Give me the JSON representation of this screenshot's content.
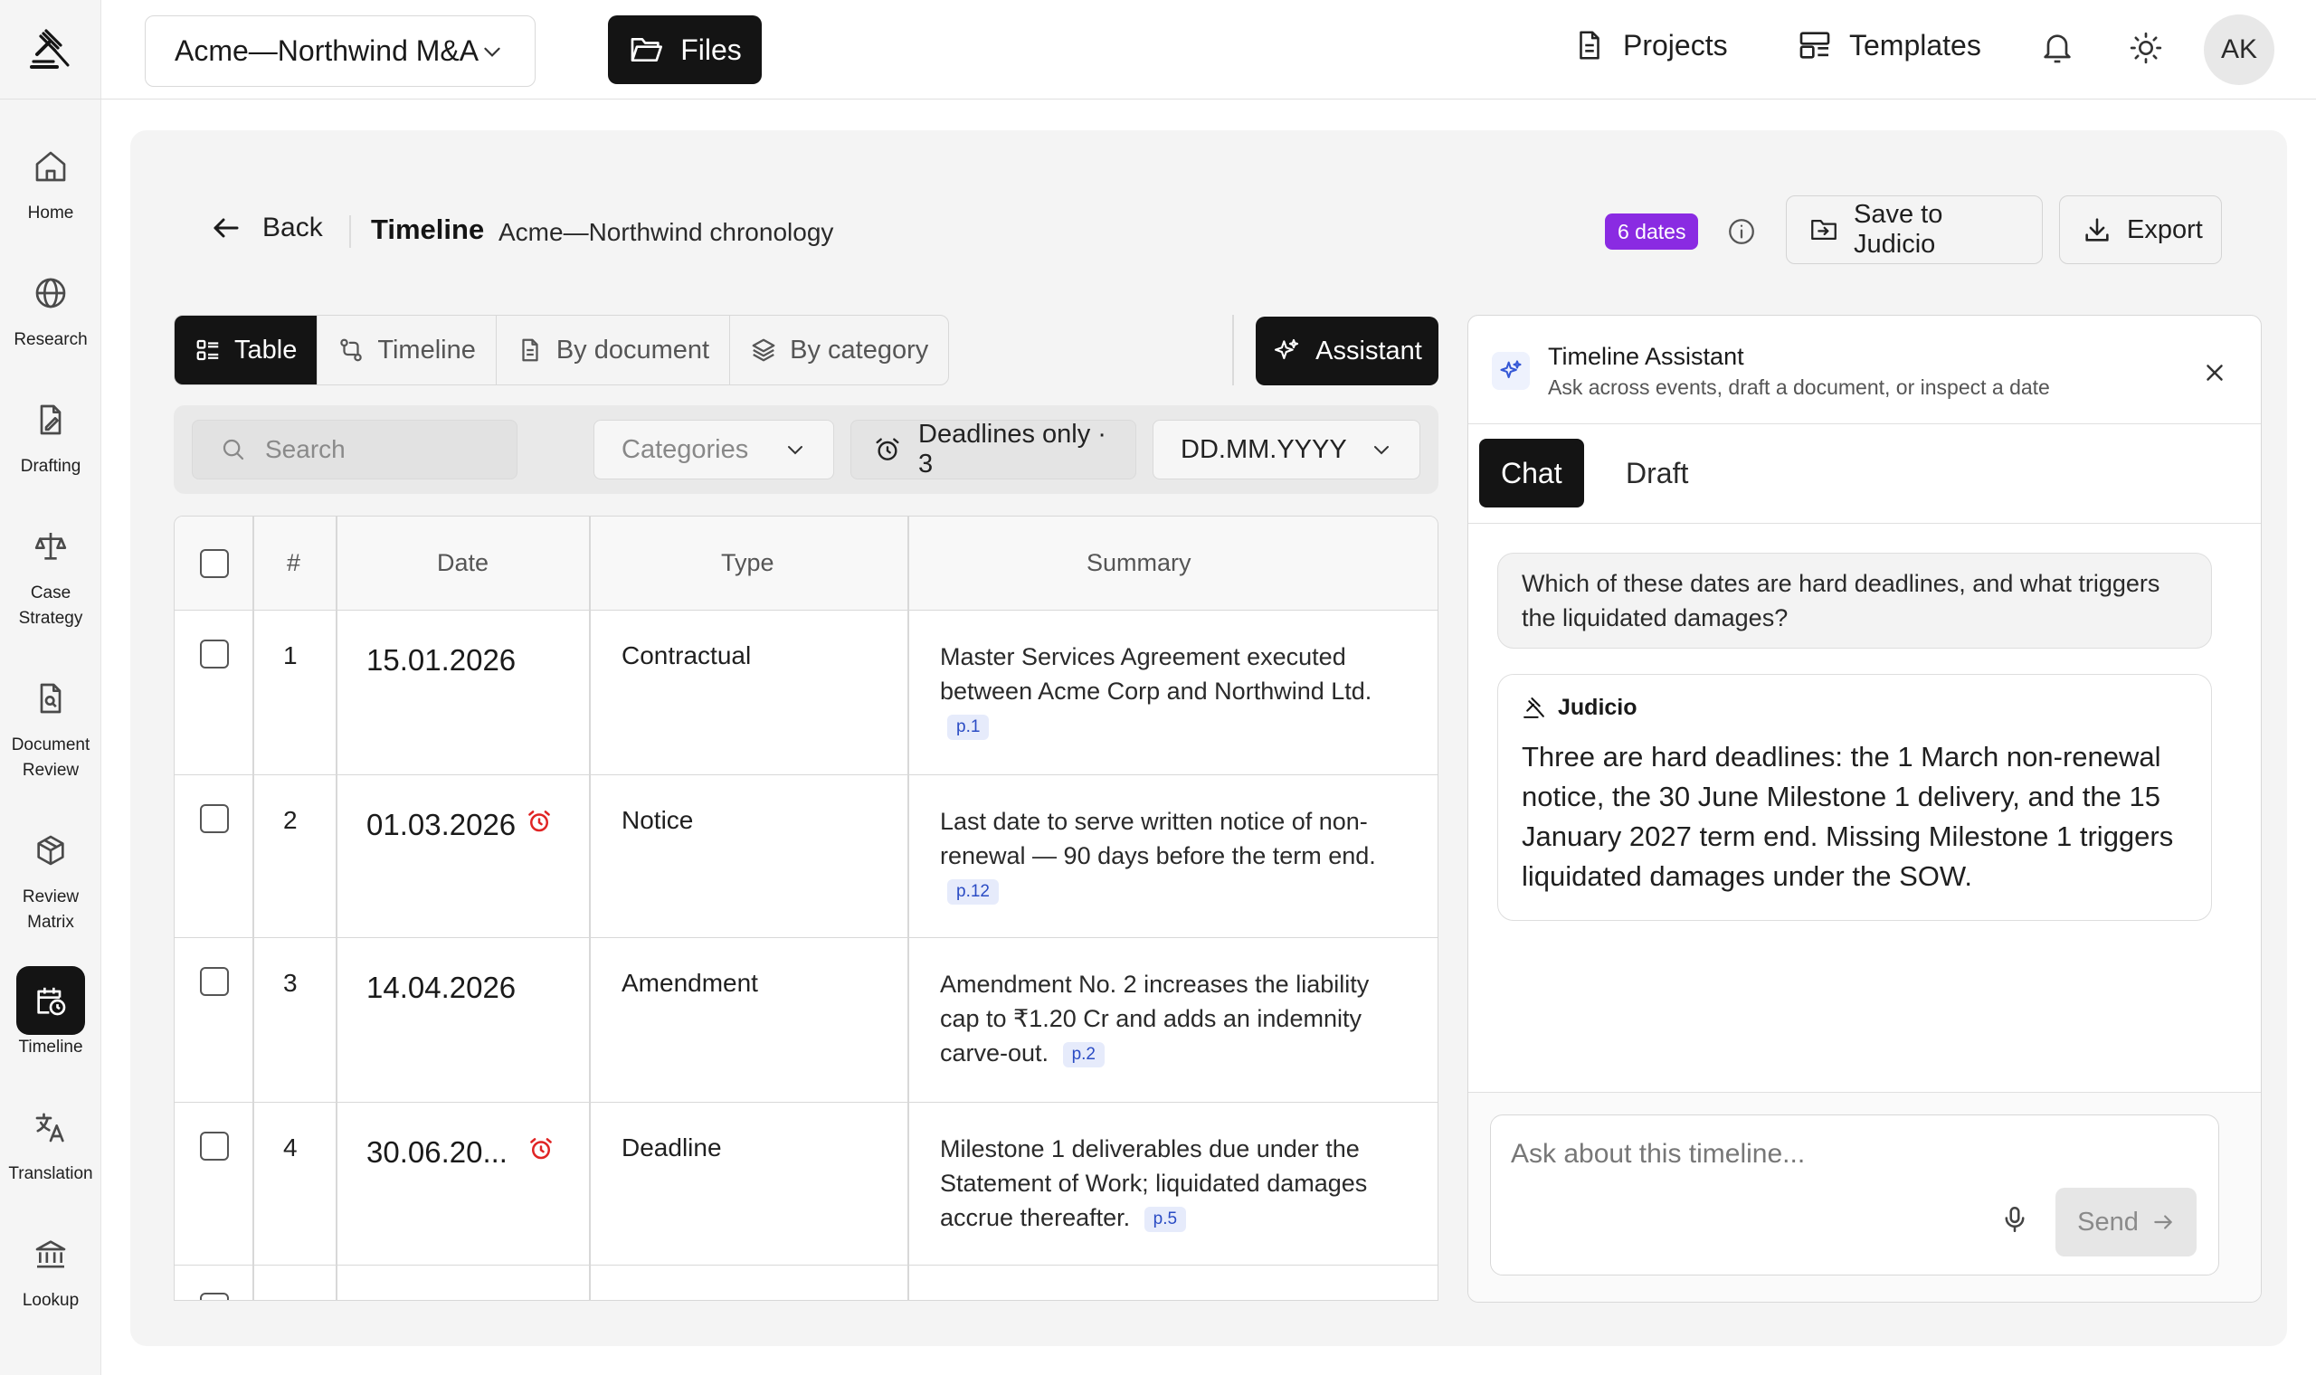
{
  "app": {
    "logo": "gavel-logo-icon"
  },
  "sidebar": {
    "items": [
      {
        "label": "Home",
        "icon": "home-icon"
      },
      {
        "label": "Research",
        "icon": "globe-icon"
      },
      {
        "label": "Drafting",
        "icon": "drafting-icon"
      },
      {
        "label": "Case Strategy",
        "icon": "scales-icon"
      },
      {
        "label": "Document Review",
        "icon": "document-search-icon"
      },
      {
        "label": "Review Matrix",
        "icon": "cube-icon"
      },
      {
        "label": "Timeline",
        "icon": "calendar-clock-icon",
        "active": true
      },
      {
        "label": "Translation",
        "icon": "translate-icon"
      },
      {
        "label": "Lookup",
        "icon": "bank-icon"
      }
    ]
  },
  "topbar": {
    "project": "Acme—Northwind M&A",
    "files_label": "Files",
    "projects_label": "Projects",
    "templates_label": "Templates",
    "avatar": "AK"
  },
  "header": {
    "back_label": "Back",
    "title": "Timeline",
    "subtitle": "Acme—Northwind chronology",
    "dates_badge": "6 dates",
    "save_label": "Save to Judicio",
    "export_label": "Export"
  },
  "views": {
    "tabs": [
      "Table",
      "Timeline",
      "By document",
      "By category"
    ],
    "active": "Table",
    "assistant_label": "Assistant"
  },
  "filters": {
    "search_placeholder": "Search",
    "categories_label": "Categories",
    "deadlines_label": "Deadlines only · 3",
    "date_format": "DD.MM.YYYY"
  },
  "table": {
    "headers": [
      "#",
      "Date",
      "Type",
      "Summary"
    ],
    "rows": [
      {
        "num": "1",
        "date": "15.01.2026",
        "type": "Contractual",
        "summary": "Master Services Agreement executed between Acme Corp and Northwind Ltd.",
        "page": "p.1",
        "deadline": false
      },
      {
        "num": "2",
        "date": "01.03.2026",
        "type": "Notice",
        "summary": "Last date to serve written notice of non-renewal — 90 days before the term end.",
        "page": "p.12",
        "deadline": true
      },
      {
        "num": "3",
        "date": "14.04.2026",
        "type": "Amendment",
        "summary": "Amendment No. 2 increases the liability cap to ₹1.20 Cr and adds an indemnity carve-out.",
        "page": "p.2",
        "deadline": false
      },
      {
        "num": "4",
        "date": "30.06.20...",
        "type": "Deadline",
        "summary": "Milestone 1 deliverables due under the Statement of Work; liquidated damages accrue thereafter.",
        "page": "p.5",
        "deadline": true
      }
    ]
  },
  "assistant": {
    "title": "Timeline Assistant",
    "subtitle": "Ask across events, draft a document, or inspect a date",
    "tabs": [
      "Chat",
      "Draft"
    ],
    "active_tab": "Chat",
    "user_message": "Which of these dates are hard deadlines, and what triggers the liquidated damages?",
    "bot_name": "Judicio",
    "bot_message": "Three are hard deadlines: the 1 March non-renewal notice, the 30 June Milestone 1 delivery, and the 15 January 2027 term end. Missing Milestone 1 triggers liquidated damages under the SOW.",
    "compose_placeholder": "Ask about this timeline...",
    "send_label": "Send"
  },
  "colors": {
    "accent_dark": "#141414",
    "badge_purple": "#8a2be2",
    "deadline_red": "#e02424",
    "page_tag_blue": "#2b4cc4"
  }
}
